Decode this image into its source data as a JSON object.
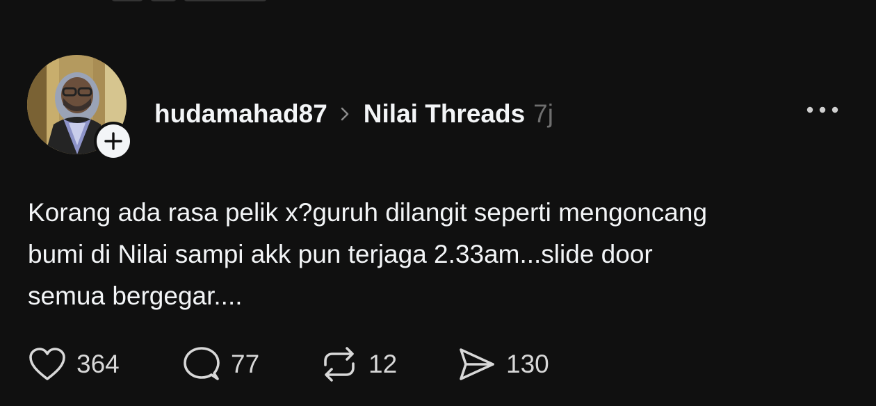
{
  "post": {
    "author": "hudamahad87",
    "community": "Nilai Threads",
    "time": "7j",
    "text": "Korang ada rasa pelik x?guruh dilangit seperti mengoncang\nbumi di Nilai sampi akk pun terjaga 2.33am...slide door\nsemua bergegar....",
    "likes": "364",
    "replies": "77",
    "reposts": "12",
    "shares": "130"
  },
  "icons": {
    "follow": "plus-icon",
    "separator": "chevron-right-icon",
    "more": "ellipsis-icon",
    "like": "heart-icon",
    "reply": "comment-bubble-icon",
    "repost": "repost-icon",
    "share": "send-icon"
  },
  "colors": {
    "background": "#101010",
    "text": "#f3f5f7",
    "muted": "#6f6f6f",
    "icon": "#d8d8d8"
  }
}
